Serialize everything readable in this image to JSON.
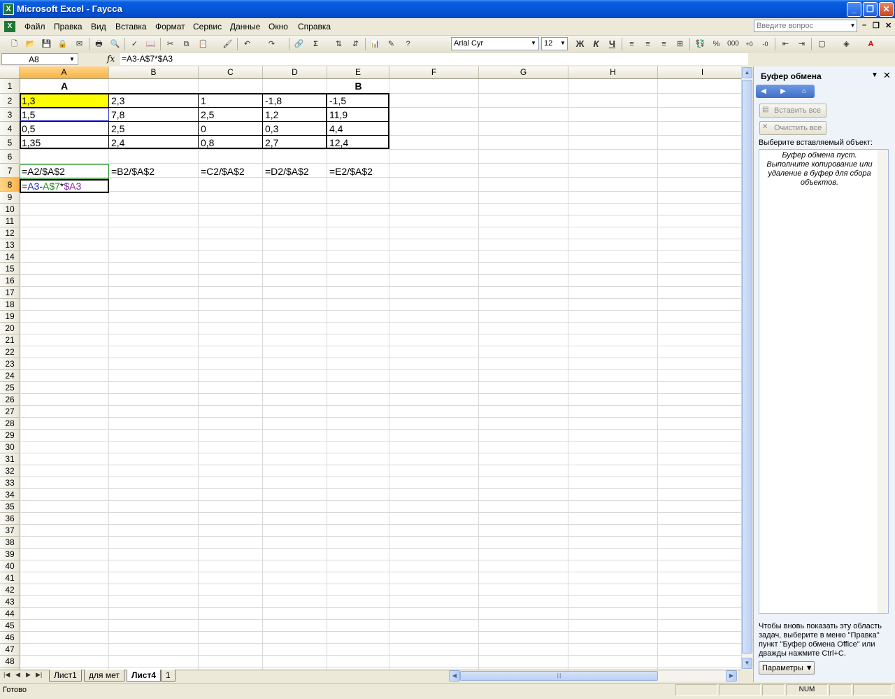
{
  "window": {
    "title": "Microsoft Excel - Гаусса"
  },
  "menu": {
    "items": [
      "Файл",
      "Правка",
      "Вид",
      "Вставка",
      "Формат",
      "Сервис",
      "Данные",
      "Окно",
      "Справка"
    ],
    "help_placeholder": "Введите вопрос"
  },
  "toolbar": {
    "font_name": "Arial Cyr",
    "font_size": "12"
  },
  "formula_bar": {
    "name_box": "A8",
    "fx": "fx",
    "formula": "=A3-A$7*$A3"
  },
  "columns": [
    "A",
    "B",
    "C",
    "D",
    "E",
    "F",
    "G",
    "H",
    "I"
  ],
  "rows": [
    "1",
    "2",
    "3",
    "4",
    "5",
    "6",
    "7",
    "8",
    "9",
    "10",
    "11",
    "12",
    "13",
    "14",
    "15",
    "16",
    "17",
    "18",
    "19",
    "20",
    "21",
    "22",
    "23",
    "24",
    "25",
    "26",
    "27",
    "28",
    "29",
    "30",
    "31",
    "32",
    "33",
    "34",
    "35",
    "36",
    "37",
    "38",
    "39",
    "40",
    "41",
    "42",
    "43",
    "44",
    "45",
    "46",
    "47",
    "48"
  ],
  "cells": {
    "A1": "A",
    "E1": "B",
    "A2": "1,3",
    "B2": "2,3",
    "C2": "1",
    "D2": "-1,8",
    "E2": "-1,5",
    "A3": "1,5",
    "B3": "7,8",
    "C3": "2,5",
    "D3": "1,2",
    "E3": "11,9",
    "A4": "0,5",
    "B4": "2,5",
    "C4": "0",
    "D4": "0,3",
    "E4": "4,4",
    "A5": "1,35",
    "B5": "2,4",
    "C5": "0,8",
    "D5": "2,7",
    "E5": "12,4",
    "A7": "=A2/$A$2",
    "B7": "=B2/$A$2",
    "C7": "=C2/$A$2",
    "D7": "=D2/$A$2",
    "E7": "=E2/$A$2",
    "A8_parts": [
      "=",
      "A3",
      "-",
      "A$7",
      "*",
      "$A3"
    ]
  },
  "colors": {
    "ref_blue": "#2020c8",
    "ref_green": "#1a8a1a",
    "ref_purple": "#7a2aa0",
    "highlight": "#ffff00"
  },
  "sheets": [
    "Лист1",
    "для мет",
    "Лист4",
    "1"
  ],
  "active_sheet": "Лист4",
  "task_pane": {
    "title": "Буфер обмена",
    "paste_all": "Вставить все",
    "clear_all": "Очистить все",
    "select_label": "Выберите вставляемый объект:",
    "empty_text": "Буфер обмена пуст. Выполните копирование или удаление в буфер для сбора объектов.",
    "hint": "Чтобы вновь показать эту область задач, выберите в меню \"Правка\" пункт \"Буфер обмена Office\" или дважды нажмите Ctrl+C.",
    "params": "Параметры"
  },
  "status": {
    "text": "Готово",
    "num": "NUM"
  }
}
